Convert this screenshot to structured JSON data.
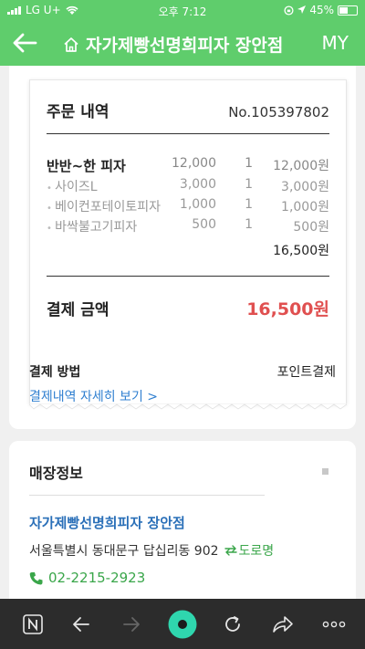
{
  "status_bar": {
    "carrier": "LG U+",
    "time": "오후 7:12",
    "battery": "45%"
  },
  "header": {
    "title": "자가제빵선명희피자 장안점",
    "my_label": "MY"
  },
  "order": {
    "title": "주문 내역",
    "order_no": "No.105397802",
    "items": [
      {
        "name": "반반~한 피자",
        "price": "12,000",
        "qty": "1",
        "amount": "12,000원"
      },
      {
        "name": "사이즈L",
        "price": "3,000",
        "qty": "1",
        "amount": "3,000원"
      },
      {
        "name": "베이컨포테이토피자",
        "price": "1,000",
        "qty": "1",
        "amount": "1,000원"
      },
      {
        "name": "바싹불고기피자",
        "price": "500",
        "qty": "1",
        "amount": "500원"
      }
    ],
    "subtotal": "16,500원",
    "total_label": "결제 금액",
    "total_value": "16,500원"
  },
  "payment": {
    "method_label": "결제 방법",
    "method_value": "포인트결제",
    "detail_link": "결제내역 자세히 보기 >"
  },
  "store": {
    "section_title": "매장정보",
    "name": "자가제빵선명희피자 장안점",
    "address": "서울특별시 동대문구 답십리동 902",
    "road_label": "도로명",
    "phone": "02-2215-2923"
  },
  "colors": {
    "brand_green": "#5fcd6c",
    "total_red": "#e05050",
    "link_blue": "#2f7fd0",
    "toolbar": "#2c2c2c"
  }
}
